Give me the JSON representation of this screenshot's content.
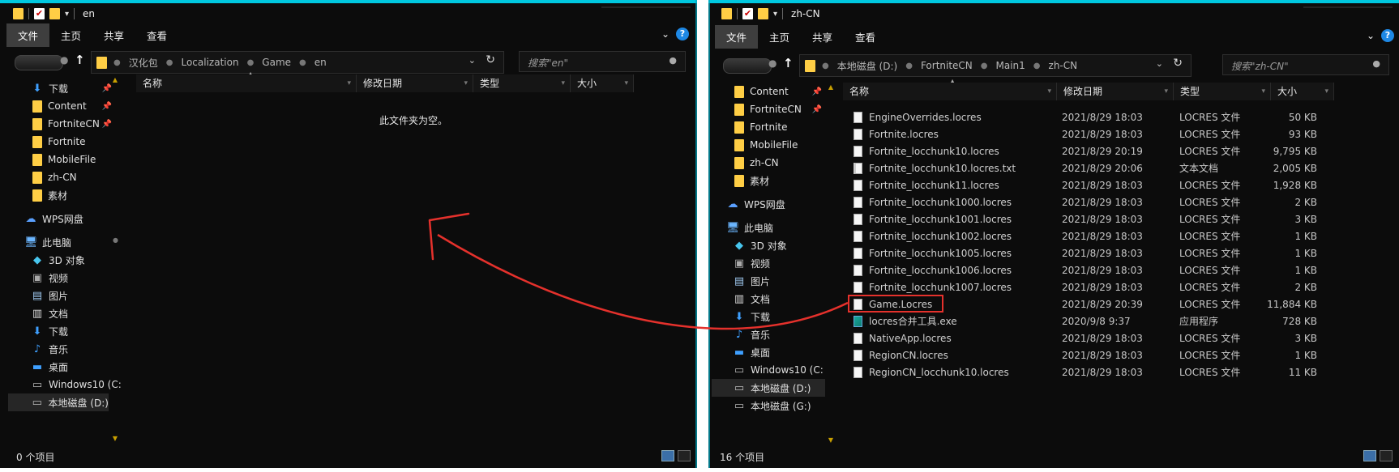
{
  "left_window": {
    "title": "en",
    "ribbon_tabs": [
      "文件",
      "主页",
      "共享",
      "查看"
    ],
    "help": "?",
    "breadcrumbs": [
      "汉化包",
      "Localization",
      "Game",
      "en"
    ],
    "search_placeholder": "搜索\"en\"",
    "nav_items": [
      {
        "label": "下载",
        "icon": "download-icon",
        "pinned": true
      },
      {
        "label": "Content",
        "icon": "folder-icon",
        "pinned": true
      },
      {
        "label": "FortniteCN",
        "icon": "folder-icon",
        "pinned": true
      },
      {
        "label": "Fortnite",
        "icon": "folder-icon",
        "pinned": false
      },
      {
        "label": "MobileFile",
        "icon": "folder-icon",
        "pinned": false
      },
      {
        "label": "zh-CN",
        "icon": "folder-icon",
        "pinned": false
      },
      {
        "label": "素材",
        "icon": "folder-icon",
        "pinned": false
      },
      {
        "label": "WPS网盘",
        "icon": "cloud-icon",
        "pinned": false
      },
      {
        "label": "此电脑",
        "icon": "computer-icon",
        "pinned": false
      },
      {
        "label": "3D 对象",
        "icon": "cube-icon",
        "pinned": false
      },
      {
        "label": "视频",
        "icon": "video-icon",
        "pinned": false
      },
      {
        "label": "图片",
        "icon": "picture-icon",
        "pinned": false
      },
      {
        "label": "文档",
        "icon": "document-icon",
        "pinned": false
      },
      {
        "label": "下载",
        "icon": "download-icon",
        "pinned": false
      },
      {
        "label": "音乐",
        "icon": "music-icon",
        "pinned": false
      },
      {
        "label": "桌面",
        "icon": "desktop-icon",
        "pinned": false
      },
      {
        "label": "Windows10 (C:",
        "icon": "drive-icon",
        "pinned": false
      },
      {
        "label": "本地磁盘 (D:)",
        "icon": "drive-icon",
        "pinned": false
      }
    ],
    "columns": [
      "名称",
      "修改日期",
      "类型",
      "大小"
    ],
    "empty_message": "此文件夹为空。",
    "status": "0 个项目"
  },
  "right_window": {
    "title": "zh-CN",
    "ribbon_tabs": [
      "文件",
      "主页",
      "共享",
      "查看"
    ],
    "help": "?",
    "breadcrumbs": [
      "本地磁盘 (D:)",
      "FortniteCN",
      "Main1",
      "zh-CN"
    ],
    "search_placeholder": "搜索\"zh-CN\"",
    "nav_items": [
      {
        "label": "Content",
        "icon": "folder-icon",
        "pinned": true
      },
      {
        "label": "FortniteCN",
        "icon": "folder-icon",
        "pinned": true
      },
      {
        "label": "Fortnite",
        "icon": "folder-icon",
        "pinned": false
      },
      {
        "label": "MobileFile",
        "icon": "folder-icon",
        "pinned": false
      },
      {
        "label": "zh-CN",
        "icon": "folder-icon",
        "pinned": false
      },
      {
        "label": "素材",
        "icon": "folder-icon",
        "pinned": false
      },
      {
        "label": "WPS网盘",
        "icon": "cloud-icon",
        "pinned": false
      },
      {
        "label": "此电脑",
        "icon": "computer-icon",
        "pinned": false
      },
      {
        "label": "3D 对象",
        "icon": "cube-icon",
        "pinned": false
      },
      {
        "label": "视频",
        "icon": "video-icon",
        "pinned": false
      },
      {
        "label": "图片",
        "icon": "picture-icon",
        "pinned": false
      },
      {
        "label": "文档",
        "icon": "document-icon",
        "pinned": false
      },
      {
        "label": "下载",
        "icon": "download-icon",
        "pinned": false
      },
      {
        "label": "音乐",
        "icon": "music-icon",
        "pinned": false
      },
      {
        "label": "桌面",
        "icon": "desktop-icon",
        "pinned": false
      },
      {
        "label": "Windows10 (C:",
        "icon": "drive-icon",
        "pinned": false
      },
      {
        "label": "本地磁盘 (D:)",
        "icon": "drive-icon",
        "pinned": false
      },
      {
        "label": "本地磁盘 (G:)",
        "icon": "drive-icon",
        "pinned": false
      }
    ],
    "columns": [
      "名称",
      "修改日期",
      "类型",
      "大小"
    ],
    "files": [
      {
        "name": "EngineOverrides.locres",
        "date": "2021/8/29 18:03",
        "type": "LOCRES 文件",
        "size": "50 KB",
        "kind": "file"
      },
      {
        "name": "Fortnite.locres",
        "date": "2021/8/29 18:03",
        "type": "LOCRES 文件",
        "size": "93 KB",
        "kind": "file"
      },
      {
        "name": "Fortnite_locchunk10.locres",
        "date": "2021/8/29 20:19",
        "type": "LOCRES 文件",
        "size": "9,795 KB",
        "kind": "file"
      },
      {
        "name": "Fortnite_locchunk10.locres.txt",
        "date": "2021/8/29 20:06",
        "type": "文本文档",
        "size": "2,005 KB",
        "kind": "txt"
      },
      {
        "name": "Fortnite_locchunk11.locres",
        "date": "2021/8/29 18:03",
        "type": "LOCRES 文件",
        "size": "1,928 KB",
        "kind": "file"
      },
      {
        "name": "Fortnite_locchunk1000.locres",
        "date": "2021/8/29 18:03",
        "type": "LOCRES 文件",
        "size": "2 KB",
        "kind": "file"
      },
      {
        "name": "Fortnite_locchunk1001.locres",
        "date": "2021/8/29 18:03",
        "type": "LOCRES 文件",
        "size": "3 KB",
        "kind": "file"
      },
      {
        "name": "Fortnite_locchunk1002.locres",
        "date": "2021/8/29 18:03",
        "type": "LOCRES 文件",
        "size": "1 KB",
        "kind": "file"
      },
      {
        "name": "Fortnite_locchunk1005.locres",
        "date": "2021/8/29 18:03",
        "type": "LOCRES 文件",
        "size": "1 KB",
        "kind": "file"
      },
      {
        "name": "Fortnite_locchunk1006.locres",
        "date": "2021/8/29 18:03",
        "type": "LOCRES 文件",
        "size": "1 KB",
        "kind": "file"
      },
      {
        "name": "Fortnite_locchunk1007.locres",
        "date": "2021/8/29 18:03",
        "type": "LOCRES 文件",
        "size": "2 KB",
        "kind": "file"
      },
      {
        "name": "Game.Locres",
        "date": "2021/8/29 20:39",
        "type": "LOCRES 文件",
        "size": "11,884 KB",
        "kind": "file"
      },
      {
        "name": "locres合并工具.exe",
        "date": "2020/9/8 9:37",
        "type": "应用程序",
        "size": "728 KB",
        "kind": "exe"
      },
      {
        "name": "NativeApp.locres",
        "date": "2021/8/29 18:03",
        "type": "LOCRES 文件",
        "size": "3 KB",
        "kind": "file"
      },
      {
        "name": "RegionCN.locres",
        "date": "2021/8/29 18:03",
        "type": "LOCRES 文件",
        "size": "1 KB",
        "kind": "file"
      },
      {
        "name": "RegionCN_locchunk10.locres",
        "date": "2021/8/29 18:03",
        "type": "LOCRES 文件",
        "size": "11 KB",
        "kind": "file"
      }
    ],
    "status": "16 个项目"
  },
  "colors": {
    "window_bg": "#0c0c0c",
    "accent_cyan": "#00c8e0",
    "folder_yellow": "#ffce45",
    "annotation_red": "#e5312c",
    "help_blue": "#1e88e5"
  }
}
